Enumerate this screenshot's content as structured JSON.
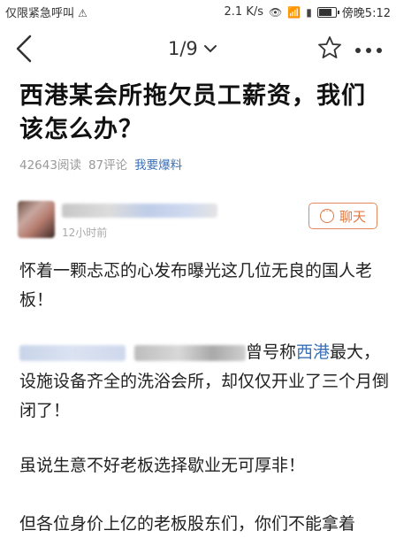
{
  "status": {
    "left_text": "仅限紧急呼叫",
    "speed": "2.1 K/s",
    "time": "傍晚5:12",
    "battery_level": 0.8
  },
  "nav": {
    "page_indicator": "1/9",
    "icons": [
      "back-arrow-icon",
      "chevron-down-icon",
      "star-icon",
      "more-icon"
    ]
  },
  "article": {
    "title": "西港某会所拖欠员工薪资，我们该怎么办？",
    "reads": "42643阅读",
    "comments": "87评论",
    "tip_link": "我要爆料",
    "author_time": "12小时前",
    "chat_label": "聊天",
    "paragraphs": {
      "p1": "怀着一颗忐忑的心发布曝光这几位无良的国人老板！",
      "p2_before": "曾号称",
      "p2_link": "西港",
      "p2_after": "最大，设施设备齐全的洗浴会所，却仅仅开业了三个月倒闭了！",
      "p3": "虽说生意不好老板选择歇业无可厚非！",
      "p4": "但各位身价上亿的老板股东们，你们不能拿着"
    }
  },
  "colors": {
    "accent_orange": "#e07a45",
    "link_blue": "#3b6fb6"
  }
}
